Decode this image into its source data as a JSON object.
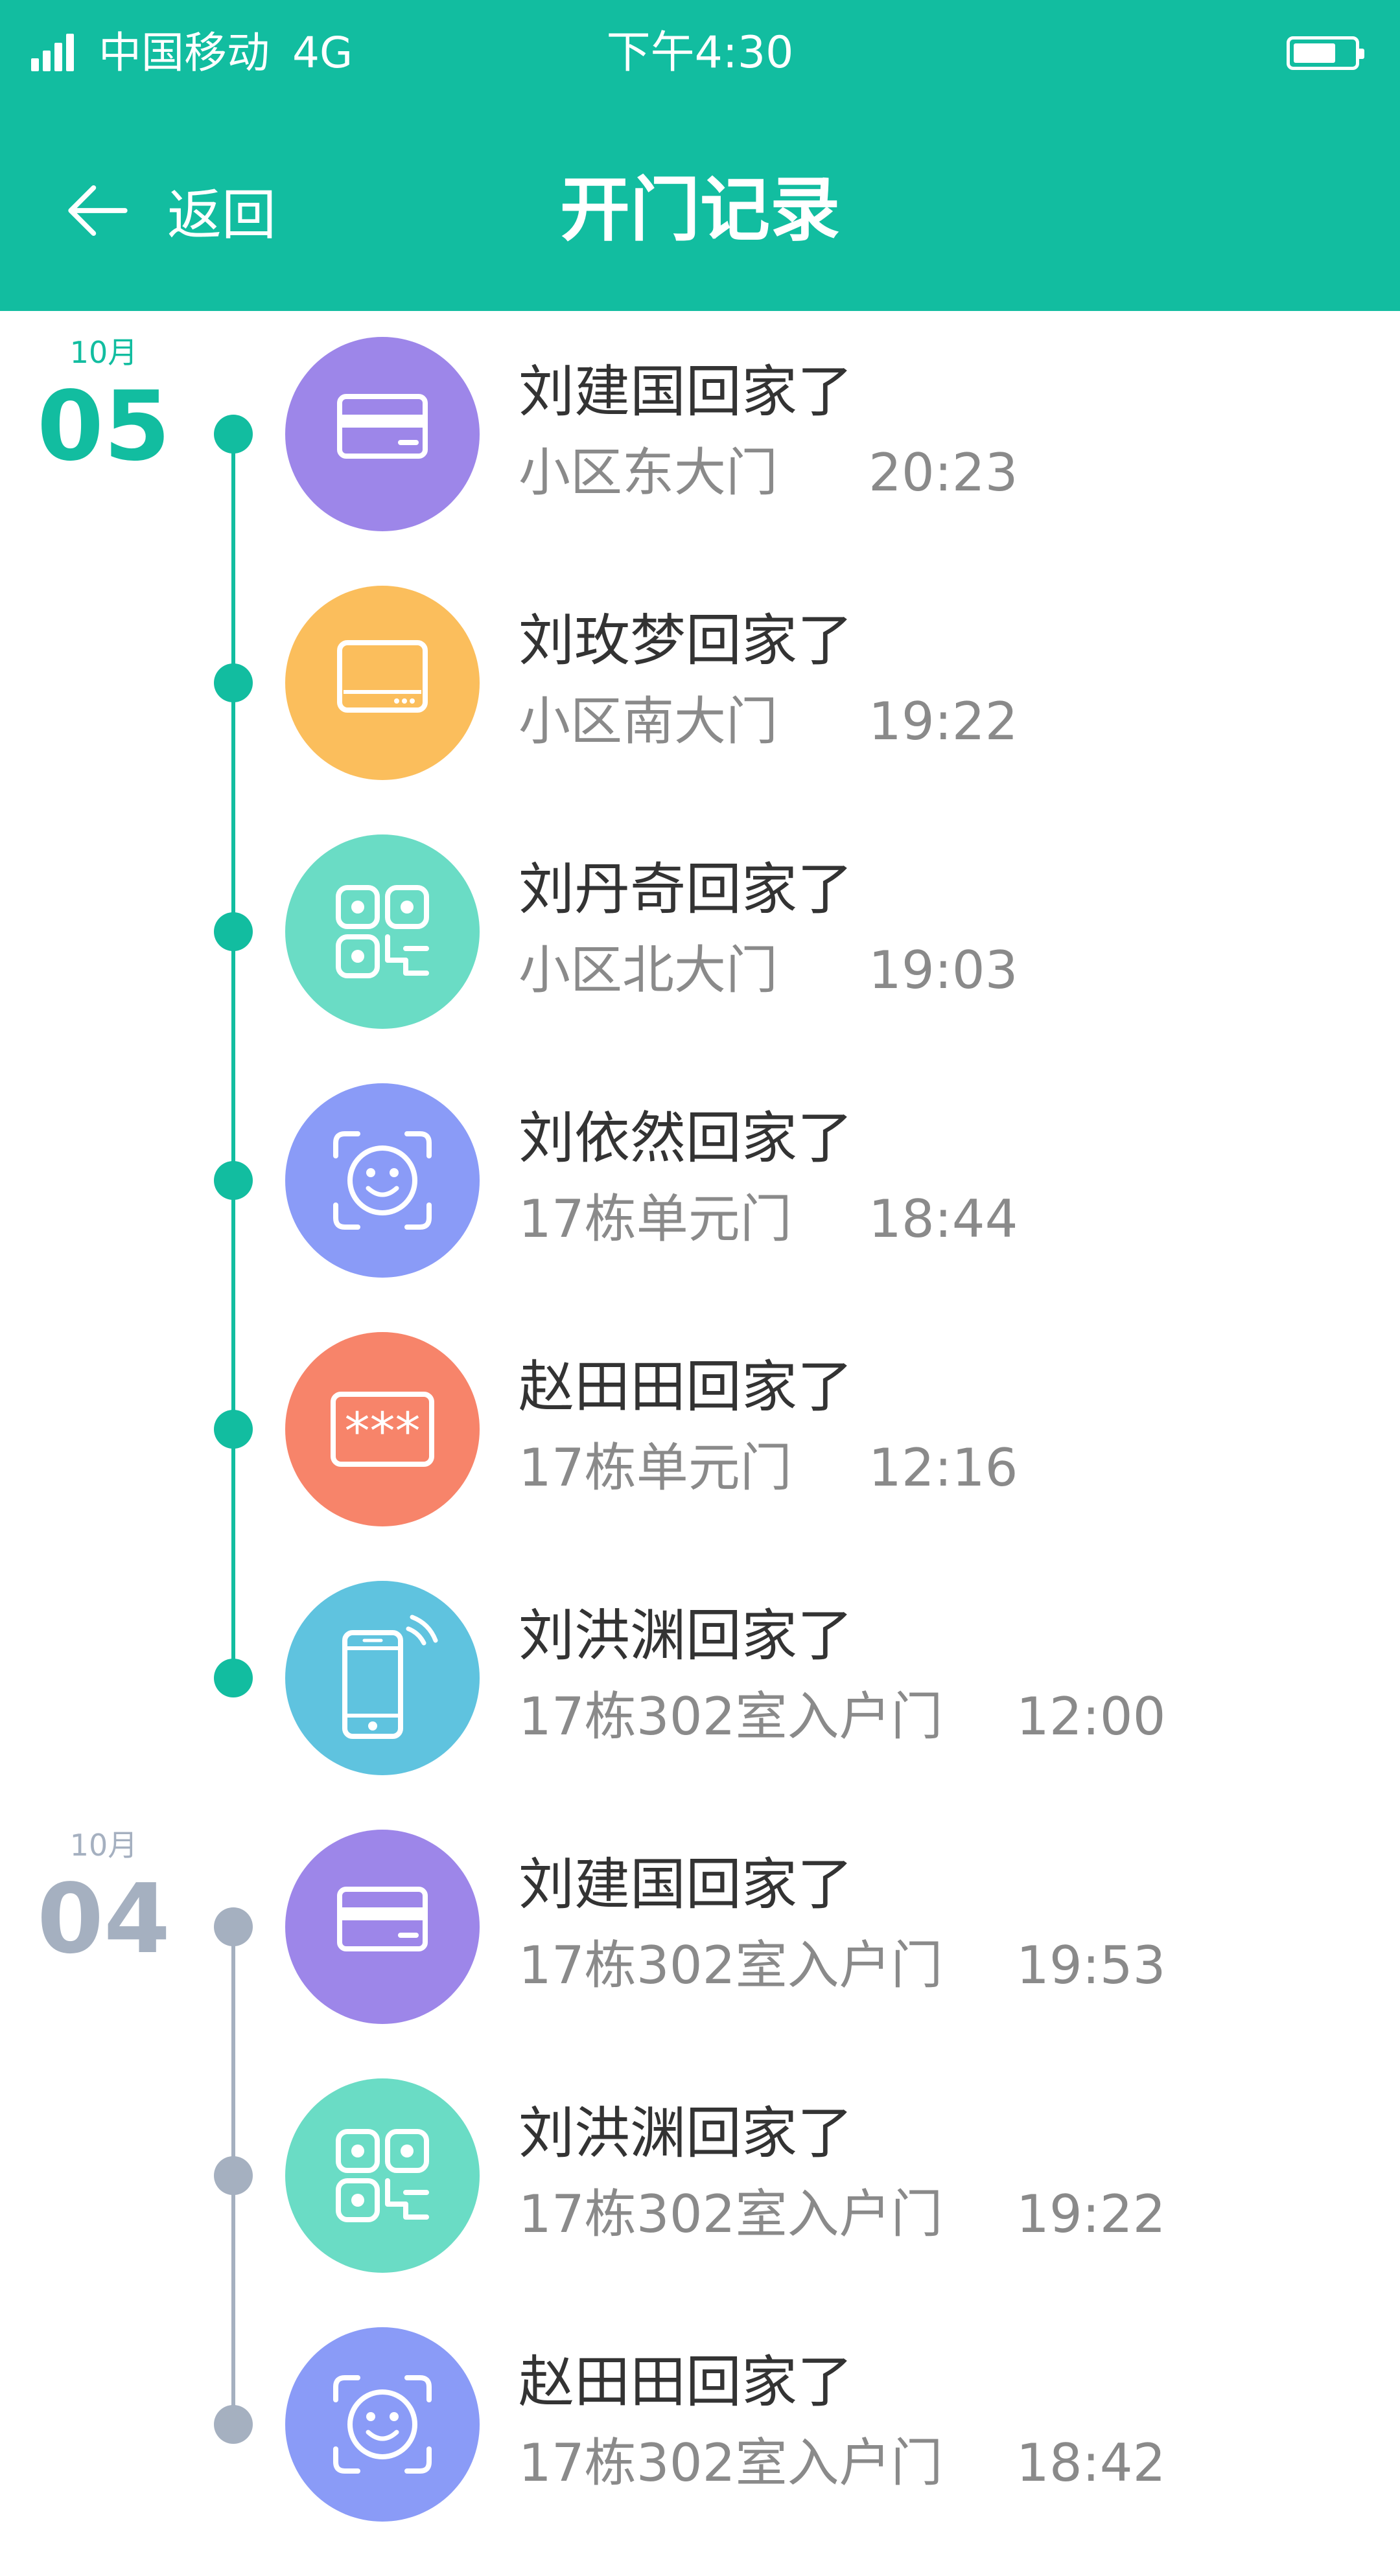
{
  "status_bar": {
    "carrier": "中国移动",
    "network": "4G",
    "time": "下午4:30"
  },
  "nav": {
    "back_label": "返回",
    "title": "开门记录"
  },
  "colors": {
    "primary": "#12BDA0",
    "inactive": "#A5B0C0",
    "card": "#9D86E9",
    "tablet": "#FBBE5C",
    "qr": "#6ADCC5",
    "face": "#8A9BF7",
    "password": "#F7846A",
    "phone": "#5FC3DF"
  },
  "groups": [
    {
      "month": "10月",
      "day": "05",
      "records": [
        {
          "name": "刘建国回家了",
          "place": "小区东大门",
          "time": "20:23",
          "icon": "card-icon"
        },
        {
          "name": "刘玫梦回家了",
          "place": "小区南大门",
          "time": "19:22",
          "icon": "tablet-icon"
        },
        {
          "name": "刘丹奇回家了",
          "place": "小区北大门",
          "time": "19:03",
          "icon": "qr-code-icon"
        },
        {
          "name": "刘依然回家了",
          "place": "17栋单元门",
          "time": "18:44",
          "icon": "face-scan-icon"
        },
        {
          "name": "赵田田回家了",
          "place": "17栋单元门",
          "time": "12:16",
          "icon": "password-icon"
        },
        {
          "name": "刘洪渊回家了",
          "place": "17栋302室入户门",
          "time": "12:00",
          "icon": "phone-nfc-icon"
        }
      ]
    },
    {
      "month": "10月",
      "day": "04",
      "records": [
        {
          "name": "刘建国回家了",
          "place": "17栋302室入户门",
          "time": "19:53",
          "icon": "card-icon"
        },
        {
          "name": "刘洪渊回家了",
          "place": "17栋302室入户门",
          "time": "19:22",
          "icon": "qr-code-icon"
        },
        {
          "name": "赵田田回家了",
          "place": "17栋302室入户门",
          "time": "18:42",
          "icon": "face-scan-icon"
        }
      ]
    }
  ]
}
